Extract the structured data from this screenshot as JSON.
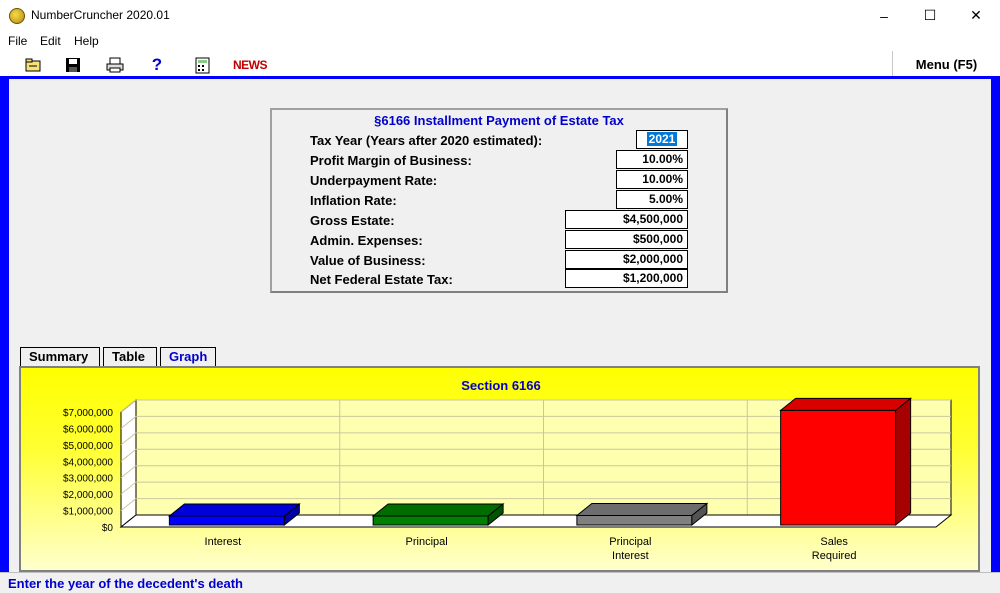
{
  "window": {
    "title": "NumberCruncher 2020.01",
    "minimize": "–",
    "maximize": "☐",
    "close": "✕"
  },
  "menu": {
    "file": "File",
    "edit": "Edit",
    "help": "Help"
  },
  "toolbar": {
    "help_glyph": "?",
    "news_label": "NEWS",
    "menu_button": "Menu (F5)"
  },
  "form": {
    "title": "§6166 Installment Payment of Estate Tax",
    "fields": [
      {
        "label": "Tax Year (Years after 2020 estimated):",
        "value": "2021"
      },
      {
        "label": "Profit Margin of Business:",
        "value": "10.00%"
      },
      {
        "label": "Underpayment Rate:",
        "value": "10.00%"
      },
      {
        "label": "Inflation Rate:",
        "value": "5.00%"
      },
      {
        "label": "Gross Estate:",
        "value": "$4,500,000"
      },
      {
        "label": "Admin. Expenses:",
        "value": "$500,000"
      },
      {
        "label": "Value of Business:",
        "value": "$2,000,000"
      },
      {
        "label": "Net Federal Estate Tax:",
        "value": "$1,200,000"
      }
    ]
  },
  "tabs": [
    {
      "label": "Summary",
      "active": false
    },
    {
      "label": "Table",
      "active": false
    },
    {
      "label": "Graph",
      "active": true
    }
  ],
  "chart_data": {
    "type": "bar",
    "title": "Section 6166",
    "categories": [
      "Interest",
      "Principal",
      "Principal\nInterest",
      "Sales\nRequired"
    ],
    "category_lines": [
      [
        "Interest"
      ],
      [
        "Principal"
      ],
      [
        "Principal",
        "Interest"
      ],
      [
        "Sales",
        "Required"
      ]
    ],
    "values": [
      0,
      600000,
      700000,
      7100000
    ],
    "colors": [
      "#0000ff",
      "#008000",
      "#808080",
      "#ff0000"
    ],
    "ylim": [
      0,
      7000000
    ],
    "ytick_labels": [
      "$0",
      "$1,000,000",
      "$2,000,000",
      "$3,000,000",
      "$4,000,000",
      "$5,000,000",
      "$6,000,000",
      "$7,000,000"
    ],
    "grid": true,
    "xlabel": "",
    "ylabel": ""
  },
  "status": {
    "message": "Enter the year of the decedent's death"
  }
}
